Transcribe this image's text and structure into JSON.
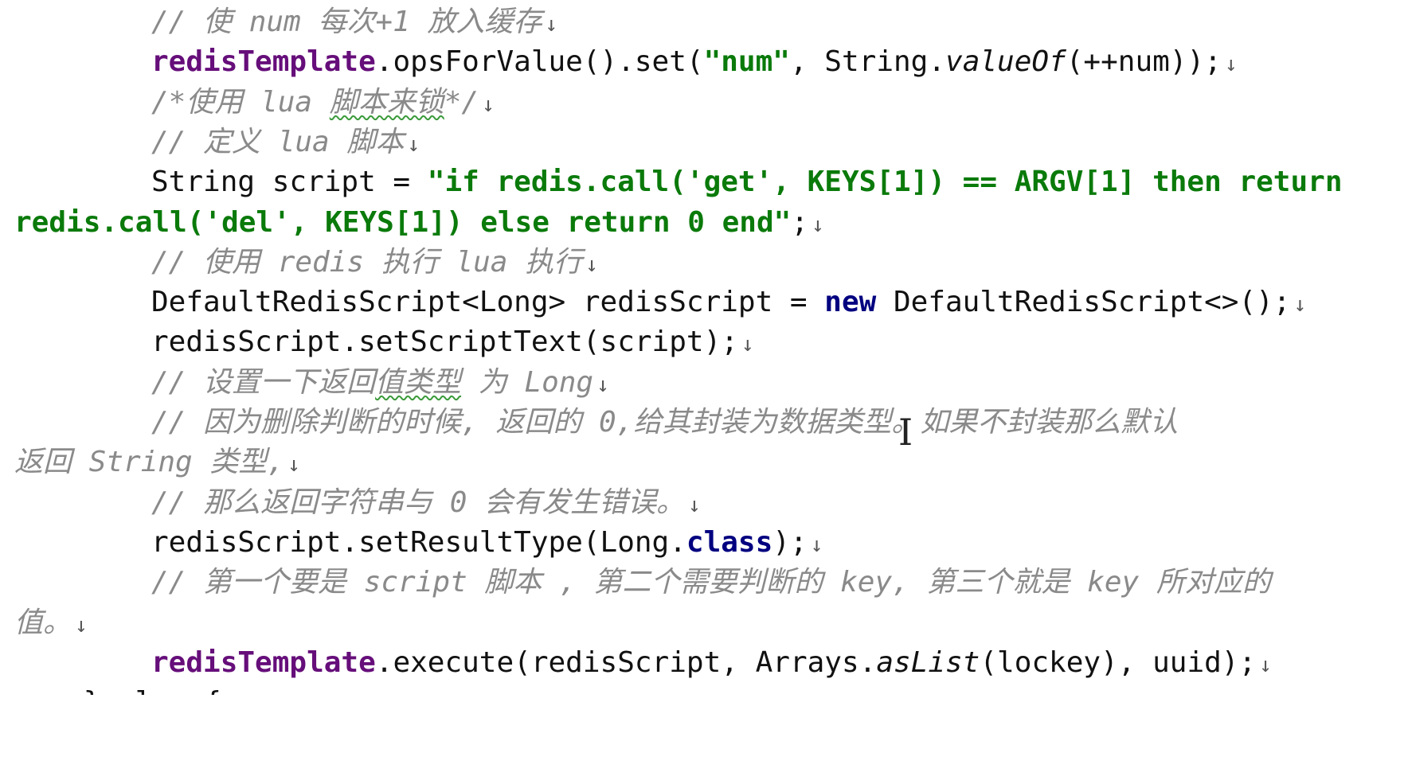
{
  "editor": {
    "paragraph_mark": "↓",
    "lines": [
      {
        "indent": true,
        "tokens": [
          {
            "t": "// 使 num 每次+1 放入缓存",
            "c": "comment"
          }
        ],
        "mark": true
      },
      {
        "indent": true,
        "tokens": [
          {
            "t": "redisTemplate",
            "c": "field"
          },
          {
            "t": ".opsForValue().set(",
            "c": "plain"
          },
          {
            "t": "\"num\"",
            "c": "string"
          },
          {
            "t": ", String.",
            "c": "plain"
          },
          {
            "t": "valueOf",
            "c": "static"
          },
          {
            "t": "(++num));",
            "c": "plain"
          }
        ],
        "mark": true
      },
      {
        "indent": true,
        "tokens": [
          {
            "t": "/*使用 lua ",
            "c": "comment"
          },
          {
            "t": "脚本来锁",
            "c": "comment",
            "squiggle": true
          },
          {
            "t": "*/",
            "c": "comment"
          }
        ],
        "mark": true
      },
      {
        "indent": true,
        "tokens": [
          {
            "t": "// 定义 lua 脚本",
            "c": "comment"
          }
        ],
        "mark": true
      },
      {
        "indent": true,
        "tokens": [
          {
            "t": "String script = ",
            "c": "plain"
          },
          {
            "t": "\"if redis.call('get', KEYS[1]) == ARGV[1] then return",
            "c": "string"
          }
        ],
        "mark": false
      },
      {
        "indent": false,
        "tokens": [
          {
            "t": "redis.call('del', KEYS[1]) else return 0 end\"",
            "c": "string"
          },
          {
            "t": ";",
            "c": "plain"
          }
        ],
        "mark": true
      },
      {
        "indent": true,
        "tokens": [
          {
            "t": "// 使用 redis 执行 lua 执行",
            "c": "comment"
          }
        ],
        "mark": true
      },
      {
        "indent": true,
        "tokens": [
          {
            "t": "DefaultRedisScript<Long> redisScript = ",
            "c": "plain"
          },
          {
            "t": "new",
            "c": "keyword"
          },
          {
            "t": " DefaultRedisScript<>();",
            "c": "plain"
          }
        ],
        "mark": true
      },
      {
        "indent": true,
        "tokens": [
          {
            "t": "redisScript.setScriptText(script);",
            "c": "plain"
          }
        ],
        "mark": true
      },
      {
        "indent": true,
        "tokens": [
          {
            "t": "// 设置一下返回",
            "c": "comment"
          },
          {
            "t": "值类型",
            "c": "comment",
            "squiggle": true
          },
          {
            "t": " 为 Long",
            "c": "comment"
          }
        ],
        "mark": true
      },
      {
        "indent": true,
        "tokens": [
          {
            "t": "// 因为删除判断的时候, 返回的 0,给其封装为数据类型。如果不封装那么默认",
            "c": "comment"
          }
        ],
        "mark": false
      },
      {
        "indent": false,
        "tokens": [
          {
            "t": "返回 String 类型,",
            "c": "comment"
          }
        ],
        "mark": true
      },
      {
        "indent": true,
        "tokens": [
          {
            "t": "// 那么返回字符串与 0 会有发生错误。",
            "c": "comment"
          }
        ],
        "mark": true
      },
      {
        "indent": true,
        "tokens": [
          {
            "t": "redisScript.setResultType(Long.",
            "c": "plain"
          },
          {
            "t": "class",
            "c": "keyword"
          },
          {
            "t": ");",
            "c": "plain"
          }
        ],
        "mark": true
      },
      {
        "indent": true,
        "tokens": [
          {
            "t": "// 第一个要是 script 脚本 , 第二个需要判断的 key, 第三个就是 key 所对应的",
            "c": "comment"
          }
        ],
        "mark": false
      },
      {
        "indent": false,
        "tokens": [
          {
            "t": "值。",
            "c": "comment"
          }
        ],
        "mark": true
      },
      {
        "indent": true,
        "tokens": [
          {
            "t": "redisTemplate",
            "c": "field"
          },
          {
            "t": ".execute(redisScript, Arrays.",
            "c": "plain"
          },
          {
            "t": "asList",
            "c": "static"
          },
          {
            "t": "(lockey), uuid);",
            "c": "plain"
          }
        ],
        "mark": true
      },
      {
        "indent": false,
        "tokens": [
          {
            "t": "    } else {",
            "c": "plain"
          }
        ],
        "mark": false
      }
    ]
  },
  "cursor": {
    "glyph": "I"
  },
  "colors": {
    "comment": "#8a8a8a",
    "field": "#660e7a",
    "string": "#0a7a0a",
    "keyword": "#000080",
    "plain": "#111111",
    "squiggle": "#3a9a3a"
  }
}
